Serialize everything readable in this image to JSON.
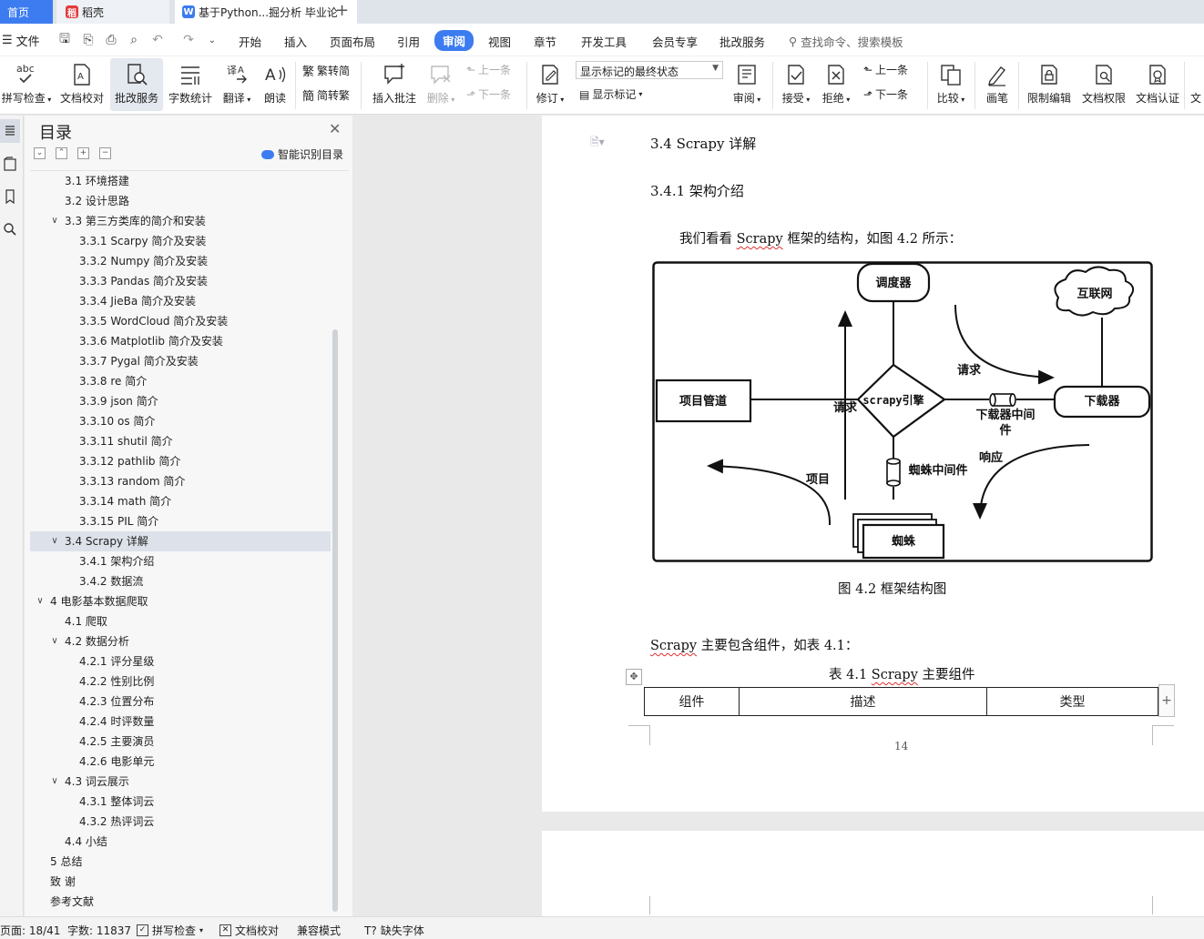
{
  "tabs": {
    "home": "首页",
    "shell": "稻壳",
    "document": "基于Python...掘分析 毕业论"
  },
  "menu": {
    "file": "文件",
    "tabs": [
      "开始",
      "插入",
      "页面布局",
      "引用",
      "审阅",
      "视图",
      "章节",
      "开发工具",
      "会员专享",
      "批改服务"
    ],
    "active_tab": "审阅",
    "search_placeholder": "查找命令、搜索模板"
  },
  "ribbon": {
    "spell_check": "拼写检查",
    "doc_proof": "文档校对",
    "correction_service": "批改服务",
    "word_count": "字数统计",
    "translate": "翻译",
    "read_aloud": "朗读",
    "trad_to_simp": "繁转简",
    "simp_to_trad": "简转繁",
    "insert_comment": "插入批注",
    "delete": "删除",
    "prev_comment": "上一条",
    "next_comment": "下一条",
    "track_changes": "修订",
    "markup_state": "显示标记的最终状态",
    "show_markup": "显示标记",
    "review": "审阅",
    "accept": "接受",
    "reject": "拒绝",
    "prev_change": "上一条",
    "next_change": "下一条",
    "compare": "比较",
    "pen": "画笔",
    "restrict_edit": "限制编辑",
    "doc_permission": "文档权限",
    "doc_certify": "文档认证",
    "more": "文"
  },
  "toc": {
    "title": "目录",
    "smart_toc": "智能识别目录",
    "items": [
      {
        "label": "3.1 环境搭建",
        "level": 2
      },
      {
        "label": "3.2 设计思路",
        "level": 2
      },
      {
        "label": "3.3  第三方类库的简介和安装",
        "level": 2,
        "expanded": true
      },
      {
        "label": "3.3.1 Scarpy 简介及安装",
        "level": 3
      },
      {
        "label": "3.3.2 Numpy 简介及安装",
        "level": 3
      },
      {
        "label": "3.3.3 Pandas 简介及安装",
        "level": 3
      },
      {
        "label": "3.3.4 JieBa 简介及安装",
        "level": 3
      },
      {
        "label": "3.3.5 WordCloud 简介及安装",
        "level": 3
      },
      {
        "label": "3.3.6 Matplotlib 简介及安装",
        "level": 3
      },
      {
        "label": "3.3.7 Pygal 简介及安装",
        "level": 3
      },
      {
        "label": "3.3.8 re 简介",
        "level": 3
      },
      {
        "label": "3.3.9 json 简介",
        "level": 3
      },
      {
        "label": "3.3.10 os 简介",
        "level": 3
      },
      {
        "label": "3.3.11 shutil 简介",
        "level": 3
      },
      {
        "label": "3.3.12 pathlib 简介",
        "level": 3
      },
      {
        "label": "3.3.13 random 简介",
        "level": 3
      },
      {
        "label": "3.3.14 math 简介",
        "level": 3
      },
      {
        "label": "3.3.15 PIL 简介",
        "level": 3
      },
      {
        "label": "3.4 Scrapy 详解",
        "level": 2,
        "expanded": true,
        "active": true
      },
      {
        "label": "3.4.1  架构介绍",
        "level": 3
      },
      {
        "label": "3.4.2  数据流",
        "level": 3
      },
      {
        "label": "4  电影基本数据爬取",
        "level": 1,
        "expanded": true
      },
      {
        "label": "4.1 爬取",
        "level": 2
      },
      {
        "label": "4.2 数据分析",
        "level": 2,
        "expanded": true
      },
      {
        "label": "4.2.1 评分星级",
        "level": 3
      },
      {
        "label": "4.2.2 性别比例",
        "level": 3
      },
      {
        "label": "4.2.3 位置分布",
        "level": 3
      },
      {
        "label": "4.2.4 时评数量",
        "level": 3
      },
      {
        "label": "4.2.5 主要演员",
        "level": 3
      },
      {
        "label": "4.2.6 电影单元",
        "level": 3
      },
      {
        "label": "4.3 词云展示",
        "level": 2,
        "expanded": true
      },
      {
        "label": "4.3.1 整体词云",
        "level": 3
      },
      {
        "label": "4.3.2 热评词云",
        "level": 3
      },
      {
        "label": "4.4 小结",
        "level": 2
      },
      {
        "label": "5  总结",
        "level": 1
      },
      {
        "label": "致    谢",
        "level": 1
      },
      {
        "label": "参考文献",
        "level": 1
      }
    ]
  },
  "document": {
    "heading": "3.4 Scrapy 详解",
    "subheading": "3.4.1  架构介绍",
    "para_prefix": "我们看看 ",
    "para_scrapy": "Scrapy",
    "para_suffix": " 框架的结构，如图 4.2 所示：",
    "diagram": {
      "scheduler": "调度器",
      "internet": "互联网",
      "pipeline": "项目管道",
      "engine": "scrapy引擎",
      "downloader": "下载器",
      "dl_middleware_1": "下载器中间",
      "dl_middleware_2": "件",
      "spider_middleware": "蜘蛛中间件",
      "spider": "蜘蛛",
      "request_top": "请求",
      "request_left": "请求",
      "response": "响应",
      "item": "项目"
    },
    "figure_caption": "图 4.2    框架结构图",
    "para2_scrapy": "Scrapy",
    "para2_rest": " 主要包含组件，如表 4.1：",
    "table_caption_prefix": "表 4.1 ",
    "table_caption_scrapy": "Scrapy",
    "table_caption_suffix": " 主要组件",
    "table_headers": [
      "组件",
      "描述",
      "类型"
    ],
    "page_number": "14"
  },
  "status": {
    "page": "页面: 18/41",
    "words": "字数: 11837",
    "spell_check": "拼写检查",
    "doc_proof": "文档校对",
    "compat_mode": "兼容模式",
    "missing_fonts": "缺失字体"
  },
  "colors": {
    "accent": "#3c7cf0",
    "spell_error": "#e03030"
  }
}
